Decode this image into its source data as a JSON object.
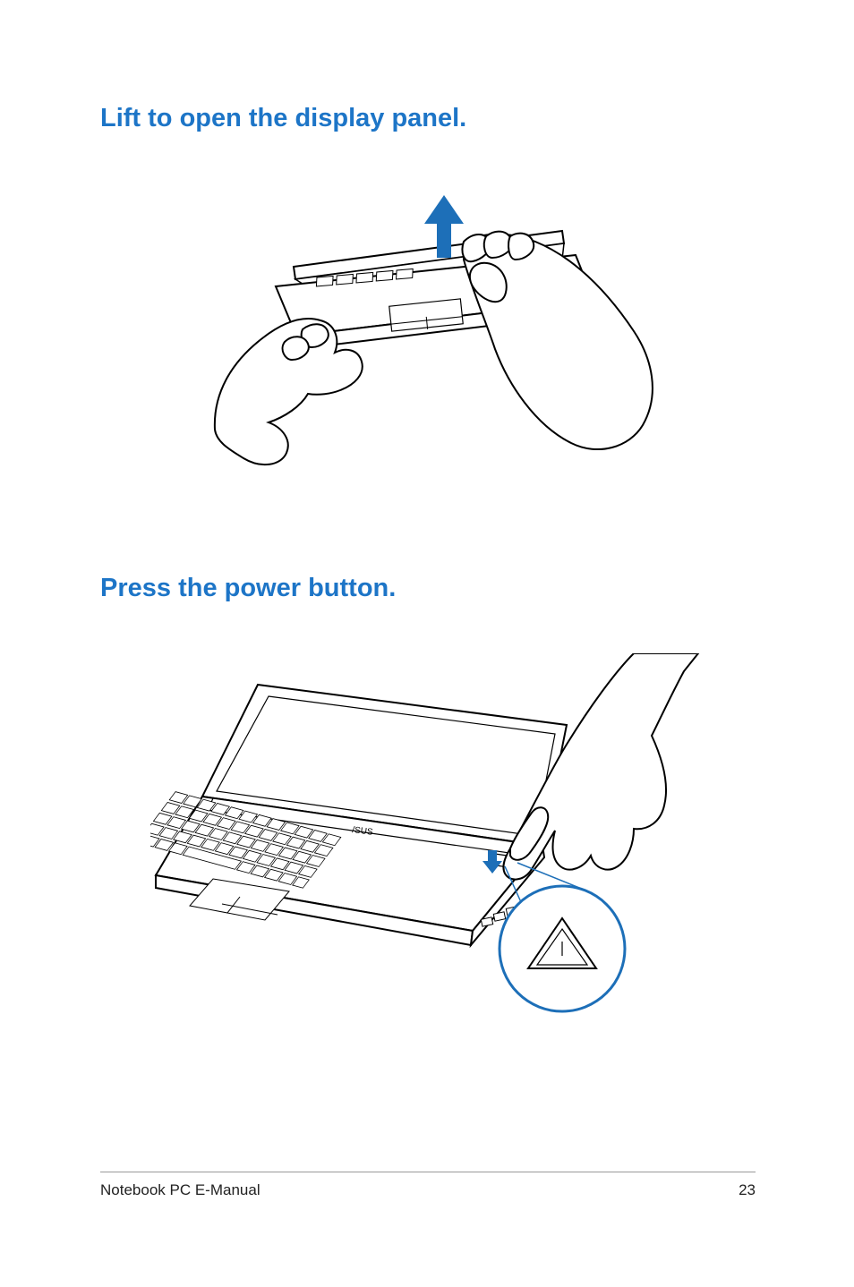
{
  "sections": {
    "heading1": "Lift to open the display panel.",
    "heading2": "Press the power button."
  },
  "footer": {
    "title": "Notebook PC E-Manual",
    "page_number": "23"
  },
  "illustrations": {
    "fig1_alt": "Two hands lifting the lid of a notebook PC with blue upward arrow",
    "fig2_alt": "Open notebook PC with a finger pressing the power button, with circular inset"
  },
  "colors": {
    "heading": "#1d75c7",
    "arrow": "#1d6fb8",
    "inset_stroke": "#1d6fb8"
  }
}
